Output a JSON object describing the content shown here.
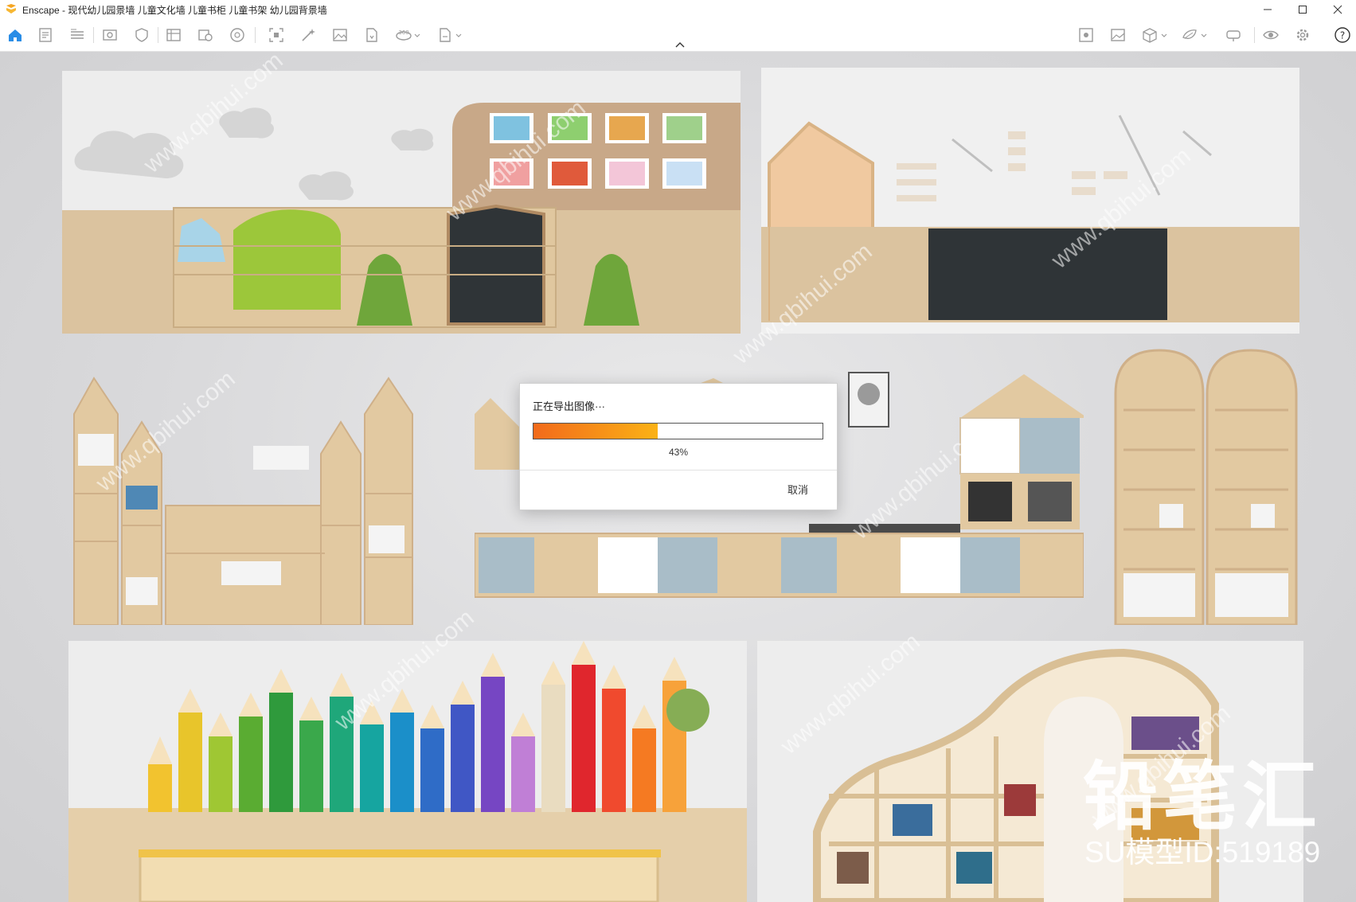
{
  "window": {
    "title": "Enscape - 现代幼儿园景墙 儿童文化墙 儿童书柜 儿童书架 幼儿园背景墙"
  },
  "toolbar": {
    "icons": [
      "home-icon",
      "document-icon",
      "bim-icon",
      "view-icon",
      "asset-icon",
      "batch-render-icon",
      "capture-icon",
      "panorama-icon",
      "screenshot-icon",
      "magic-icon",
      "image-icon",
      "file-export-icon",
      "vr360-icon",
      "export-icon",
      "sun-icon",
      "gallery-icon",
      "box-icon",
      "layers-icon",
      "headset-icon",
      "eye-icon",
      "settings-icon",
      "help-icon"
    ]
  },
  "dialog": {
    "title": "正在导出图像···",
    "progress_percent": 43,
    "percent_label": "43%",
    "cancel_label": "取消",
    "progress_colors": [
      "#f26a1b",
      "#fbb216"
    ]
  },
  "watermark": {
    "brand": "铅笔汇",
    "model_id": "SU模型ID:519189",
    "site": "www.qbihui.com"
  }
}
